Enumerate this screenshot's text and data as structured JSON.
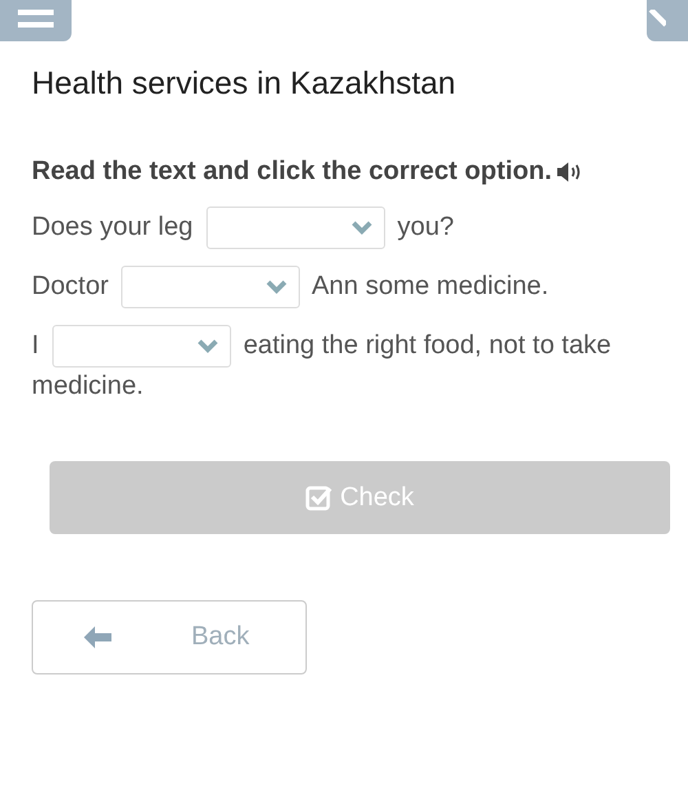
{
  "title": "Health services in Kazakhstan",
  "instruction": "Read the text and click the correct option.",
  "sentences": [
    {
      "parts": [
        {
          "kind": "text",
          "text": "Does your leg"
        },
        {
          "kind": "dropdown"
        },
        {
          "kind": "text",
          "text": "you?"
        }
      ]
    },
    {
      "parts": [
        {
          "kind": "text",
          "text": "Doctor"
        },
        {
          "kind": "dropdown"
        },
        {
          "kind": "text",
          "text": "Ann some medicine."
        }
      ]
    },
    {
      "parts": [
        {
          "kind": "text",
          "text": "I"
        },
        {
          "kind": "dropdown"
        },
        {
          "kind": "text",
          "text": "eating the right food, not to take"
        },
        {
          "kind": "text",
          "text": "medicine."
        }
      ]
    }
  ],
  "check_button": {
    "label": "Check",
    "disabled": true
  },
  "back_button": {
    "label": "Back"
  }
}
